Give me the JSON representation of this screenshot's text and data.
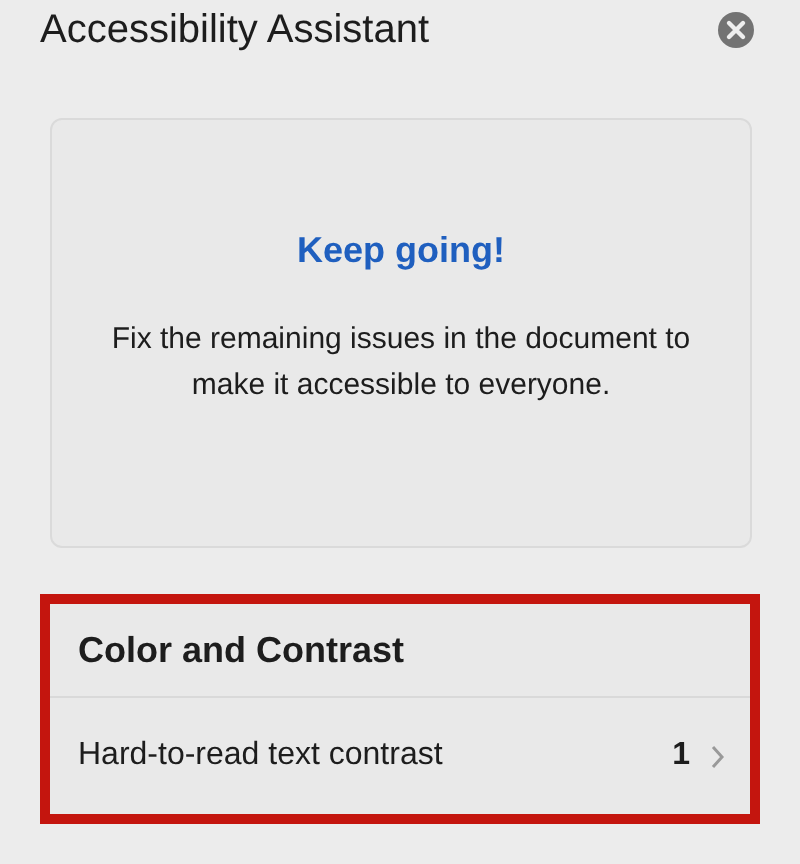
{
  "panel": {
    "title": "Accessibility Assistant"
  },
  "status_card": {
    "heading": "Keep going!",
    "message": "Fix the remaining issues in the document to make it accessible to everyone."
  },
  "sections": [
    {
      "title": "Color and Contrast",
      "highlighted": true,
      "issues": [
        {
          "label": "Hard-to-read text contrast",
          "count": "1"
        }
      ]
    }
  ]
}
